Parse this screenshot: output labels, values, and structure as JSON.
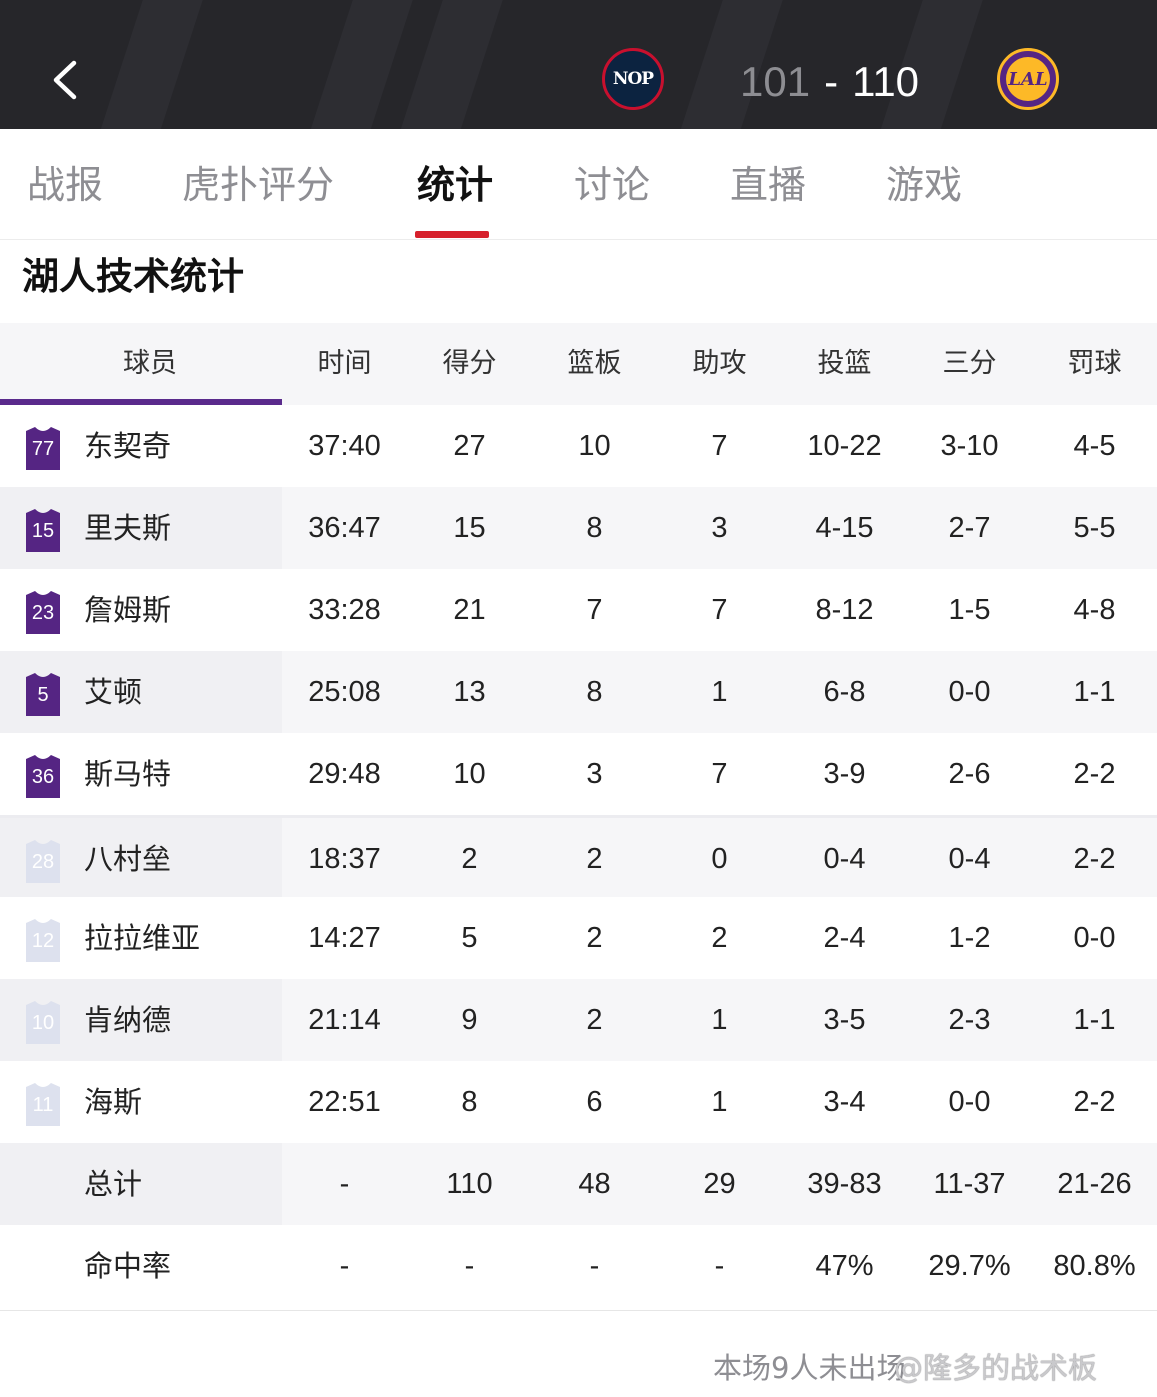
{
  "header": {
    "away_team": "NOP",
    "home_team": "LAL",
    "away_score": "101",
    "separator": "-",
    "home_score": "110",
    "colors": {
      "background": "#26262a",
      "lakers_purple": "#552583",
      "lakers_gold": "#fdb927",
      "pelicans_navy": "#0c2340",
      "pelicans_red": "#c8102e"
    }
  },
  "tabs": [
    {
      "label": "战报",
      "active": false
    },
    {
      "label": "虎扑评分",
      "active": false
    },
    {
      "label": "统计",
      "active": true
    },
    {
      "label": "讨论",
      "active": false
    },
    {
      "label": "直播",
      "active": false
    },
    {
      "label": "游戏",
      "active": false
    }
  ],
  "section_title": "湖人技术统计",
  "table": {
    "columns": [
      "球员",
      "时间",
      "得分",
      "篮板",
      "助攻",
      "投篮",
      "三分",
      "罚球"
    ],
    "starters": [
      {
        "number": "77",
        "name": "东契奇",
        "min": "37:40",
        "pts": "27",
        "reb": "10",
        "ast": "7",
        "fg": "10-22",
        "tp": "3-10",
        "ft": "4-5"
      },
      {
        "number": "15",
        "name": "里夫斯",
        "min": "36:47",
        "pts": "15",
        "reb": "8",
        "ast": "3",
        "fg": "4-15",
        "tp": "2-7",
        "ft": "5-5"
      },
      {
        "number": "23",
        "name": "詹姆斯",
        "min": "33:28",
        "pts": "21",
        "reb": "7",
        "ast": "7",
        "fg": "8-12",
        "tp": "1-5",
        "ft": "4-8"
      },
      {
        "number": "5",
        "name": "艾顿",
        "min": "25:08",
        "pts": "13",
        "reb": "8",
        "ast": "1",
        "fg": "6-8",
        "tp": "0-0",
        "ft": "1-1"
      },
      {
        "number": "36",
        "name": "斯马特",
        "min": "29:48",
        "pts": "10",
        "reb": "3",
        "ast": "7",
        "fg": "3-9",
        "tp": "2-6",
        "ft": "2-2"
      }
    ],
    "bench": [
      {
        "number": "28",
        "name": "八村垒",
        "min": "18:37",
        "pts": "2",
        "reb": "2",
        "ast": "0",
        "fg": "0-4",
        "tp": "0-4",
        "ft": "2-2"
      },
      {
        "number": "12",
        "name": "拉拉维亚",
        "min": "14:27",
        "pts": "5",
        "reb": "2",
        "ast": "2",
        "fg": "2-4",
        "tp": "1-2",
        "ft": "0-0"
      },
      {
        "number": "10",
        "name": "肯纳德",
        "min": "21:14",
        "pts": "9",
        "reb": "2",
        "ast": "1",
        "fg": "3-5",
        "tp": "2-3",
        "ft": "1-1"
      },
      {
        "number": "11",
        "name": "海斯",
        "min": "22:51",
        "pts": "8",
        "reb": "6",
        "ast": "1",
        "fg": "3-4",
        "tp": "0-0",
        "ft": "2-2"
      }
    ],
    "totals": {
      "name": "总计",
      "min": "-",
      "pts": "110",
      "reb": "48",
      "ast": "29",
      "fg": "39-83",
      "tp": "11-37",
      "ft": "21-26"
    },
    "percentages": {
      "name": "命中率",
      "min": "-",
      "pts": "-",
      "reb": "-",
      "ast": "-",
      "fg": "47%",
      "tp": "29.7%",
      "ft": "80.8%"
    }
  },
  "footer_note": "本场9人未出场",
  "watermark": "@隆多的战术板",
  "icons": {
    "back": "chevron-left-icon",
    "jersey": "jersey-icon"
  }
}
